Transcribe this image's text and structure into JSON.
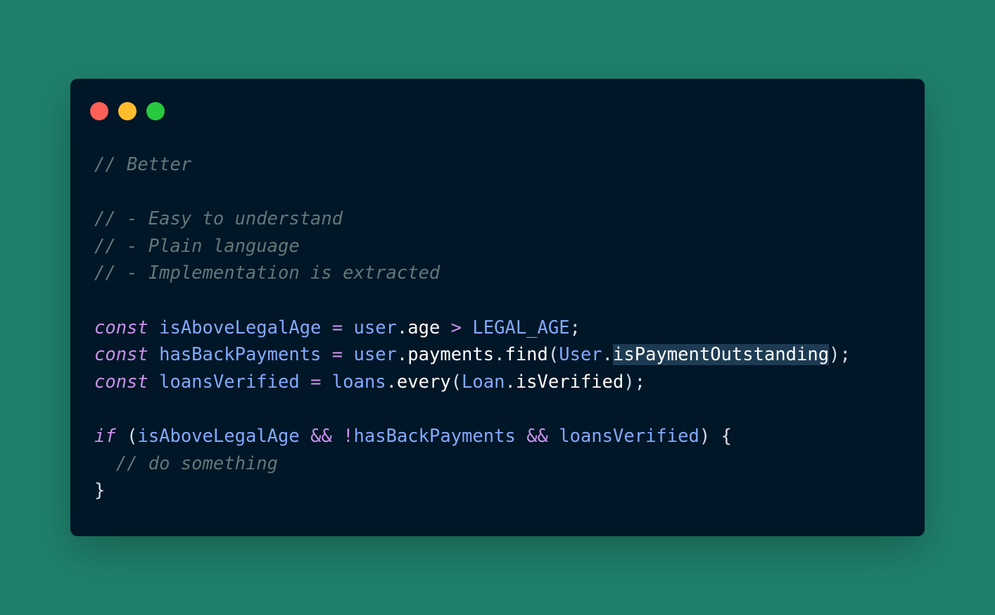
{
  "colors": {
    "background": "#1f806c",
    "window": "#011627",
    "close": "#ff5f56",
    "minimize": "#ffbd2e",
    "zoom": "#27c93f",
    "comment": "#637777",
    "keyword": "#c792ea",
    "variable": "#82aaff",
    "property": "#ffffff",
    "punctuation": "#d6deeb",
    "selection": "#1d3b53"
  },
  "window_controls": {
    "close_icon": "close-icon",
    "minimize_icon": "minimize-icon",
    "zoom_icon": "zoom-icon"
  },
  "code": {
    "line1": {
      "comment": "// Better"
    },
    "line3": {
      "comment": "// - Easy to understand"
    },
    "line4": {
      "comment": "// - Plain language"
    },
    "line5": {
      "comment": "// - Implementation is extracted"
    },
    "line7": {
      "kw": "const",
      "name": "isAboveLegalAge",
      "eq": "=",
      "obj": "user",
      "dot": ".",
      "prop": "age",
      "op": ">",
      "constant": "LEGAL_AGE",
      "semi": ";"
    },
    "line8": {
      "kw": "const",
      "name": "hasBackPayments",
      "eq": "=",
      "obj": "user",
      "dot1": ".",
      "prop": "payments",
      "dot2": ".",
      "method": "find",
      "paren_open": "(",
      "cls": "User",
      "dot3": ".",
      "selected": "isPaymentOutstanding",
      "paren_close": ")",
      "semi": ";"
    },
    "line9": {
      "kw": "const",
      "name": "loansVerified",
      "eq": "=",
      "obj": "loans",
      "dot1": ".",
      "method": "every",
      "paren_open": "(",
      "cls": "Loan",
      "dot2": ".",
      "prop": "isVerified",
      "paren_close": ")",
      "semi": ";"
    },
    "line11": {
      "kw": "if",
      "paren_open": "(",
      "a": "isAboveLegalAge",
      "and1": "&&",
      "not": "!",
      "b": "hasBackPayments",
      "and2": "&&",
      "c": "loansVerified",
      "paren_close": ")",
      "brace": "{"
    },
    "line12": {
      "comment": "// do something"
    },
    "line13": {
      "brace": "}"
    }
  }
}
